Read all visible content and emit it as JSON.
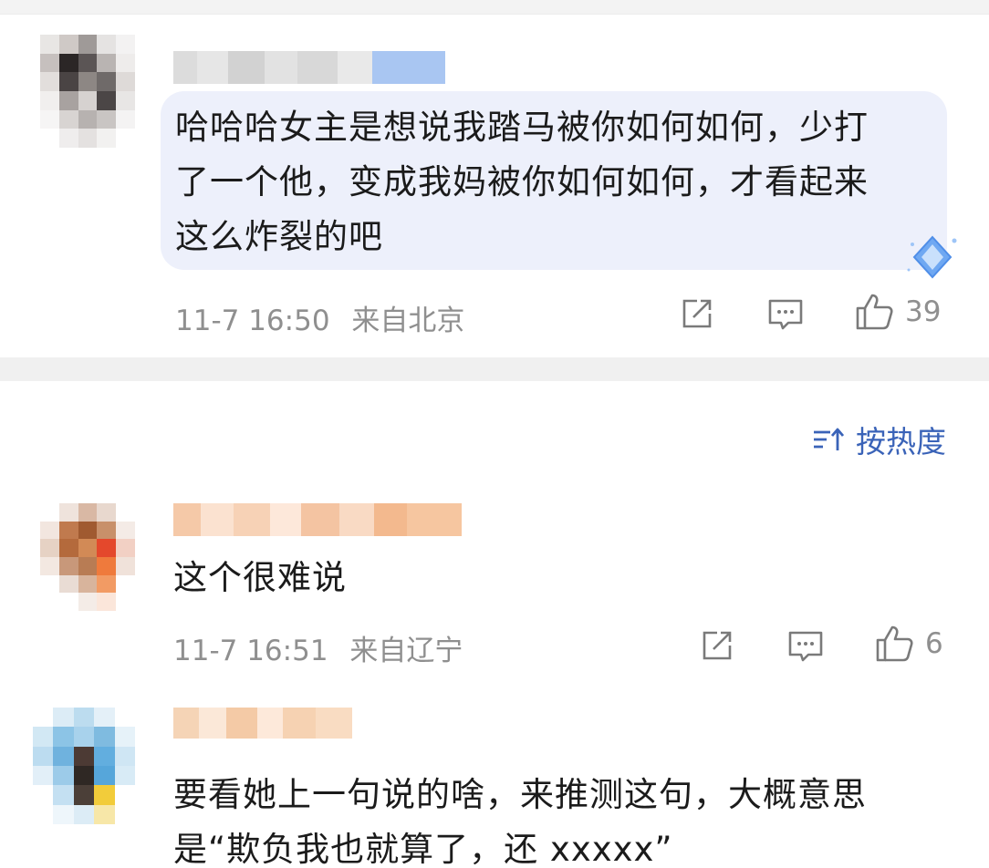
{
  "comments": [
    {
      "text_lines": [
        "哈哈哈女主是想说我踏马被你如何如何，少打",
        "了一个他，变成我妈被你如何如何，才看起来",
        "这么炸裂的吧"
      ],
      "time": "11-7 16:50",
      "location": "来自北京",
      "likes": "39"
    },
    {
      "text_lines": [
        "这个很难说"
      ],
      "time": "11-7 16:51",
      "location": "来自辽宁",
      "likes": "6"
    },
    {
      "text_lines": [
        "要看她上一句说的啥，来推测这句，大概意思",
        "是“欺负我也就算了，还 xxxxx”"
      ]
    }
  ],
  "sort": {
    "icon": "sort-icon",
    "label": "按热度"
  },
  "icons": {
    "share": "share-icon",
    "comment": "comment-icon",
    "like": "thumbs-up-icon",
    "badge": "diamond-badge-icon"
  },
  "colors": {
    "accent": "#3a63b8",
    "bubble": "#edf0fb",
    "meta": "#8f8f8f",
    "divider": "#f0f0f0"
  }
}
